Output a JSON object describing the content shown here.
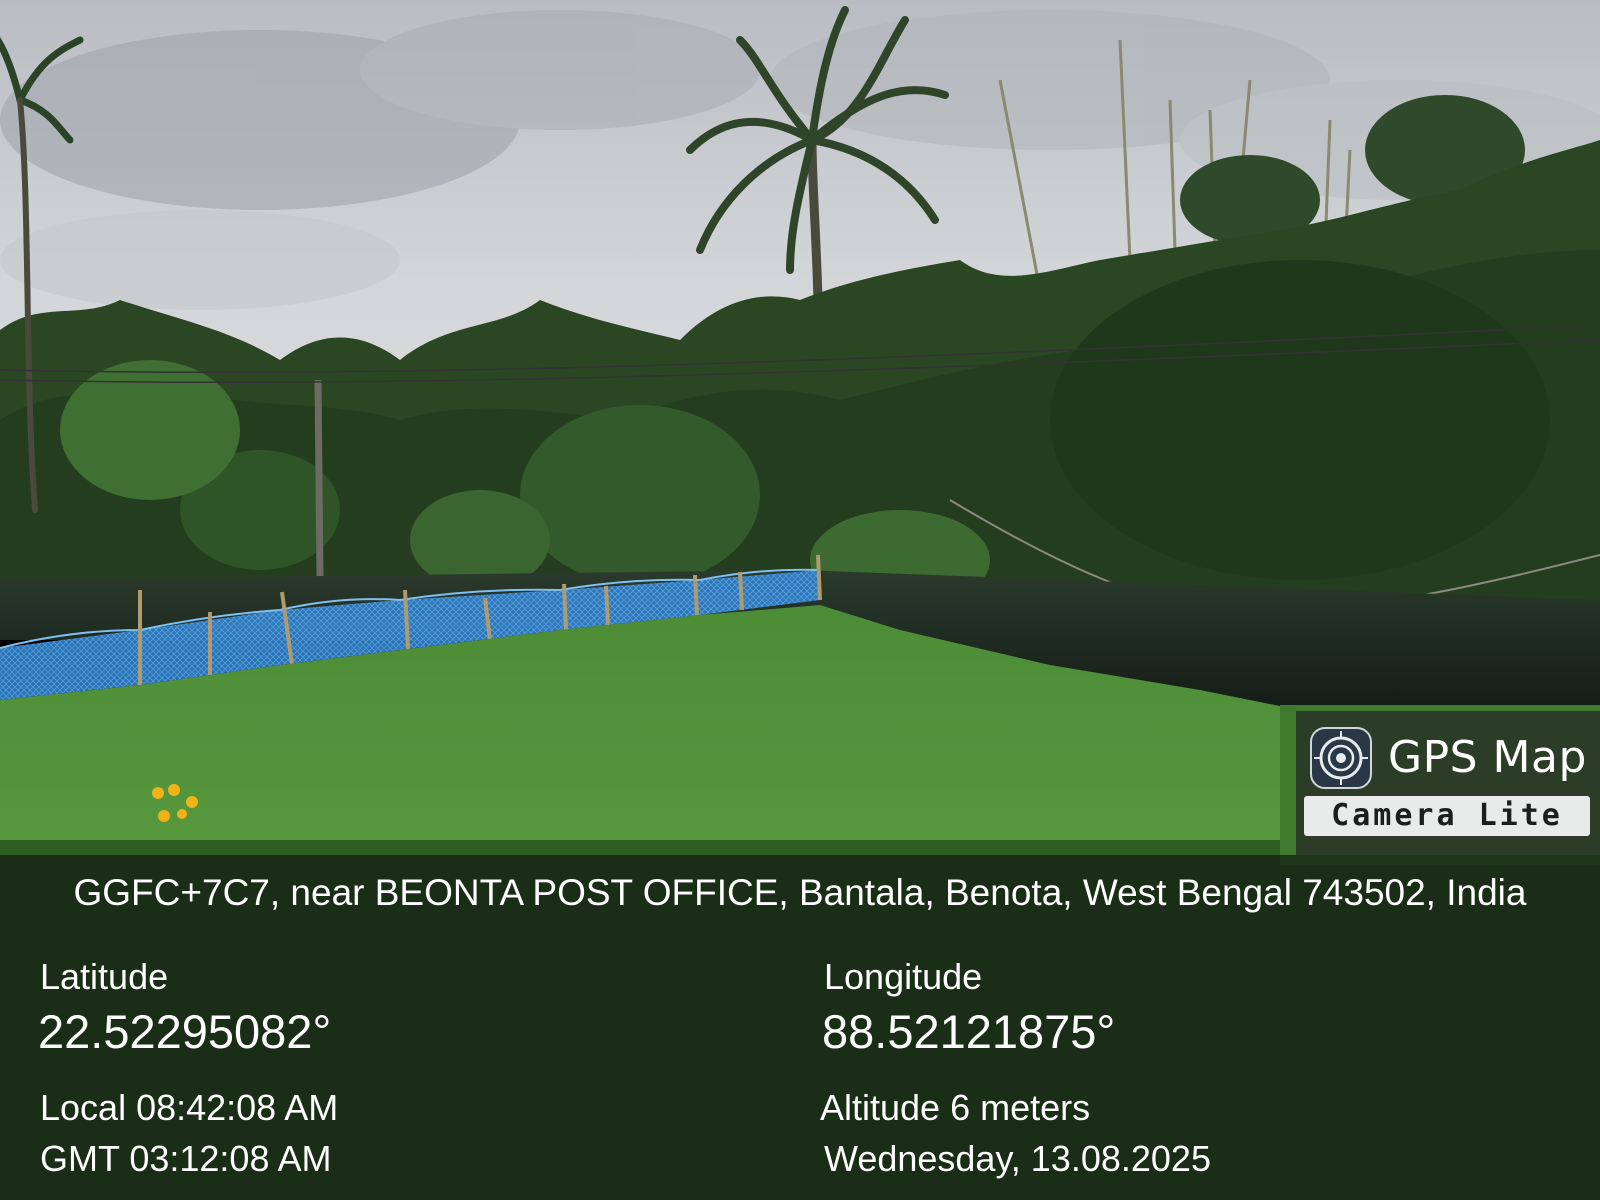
{
  "badge": {
    "title": "GPS Map",
    "subtitle": "Camera Lite",
    "icon": "camera-lens-icon"
  },
  "location": {
    "address": "GGFC+7C7, near BEONTA POST OFFICE, Bantala, Benota, West Bengal 743502, India",
    "latitude_label": "Latitude",
    "latitude_value": "22.52295082°",
    "longitude_label": "Longitude",
    "longitude_value": "88.52121875°",
    "local_time": "Local 08:42:08 AM",
    "gmt_time": "GMT 03:12:08 AM",
    "altitude": "Altitude 6 meters",
    "date": "Wednesday, 13.08.2025"
  },
  "colors": {
    "sky": "#c9ccd0",
    "foliage": "#2c4a22",
    "grass": "#4a8a35",
    "net": "#3f8fd6",
    "water": "#1f2a22",
    "panel": "#121a10"
  }
}
